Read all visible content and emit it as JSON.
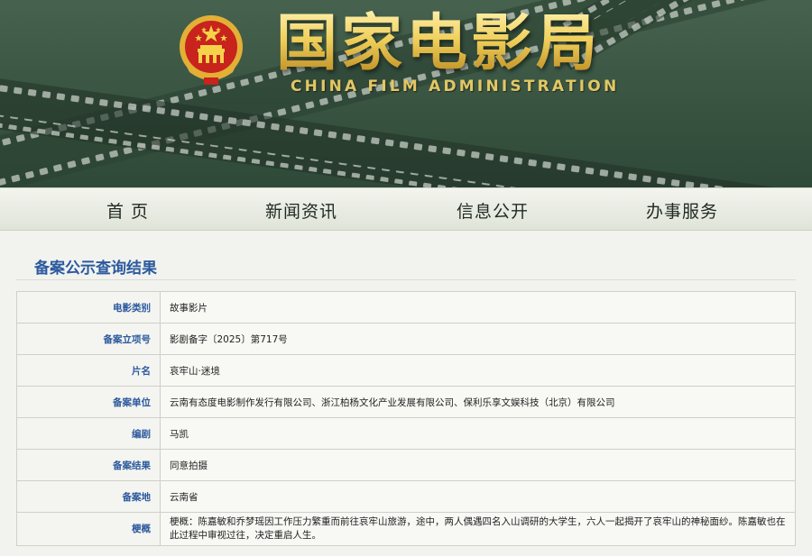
{
  "header": {
    "title_cn": "国家电影局",
    "title_en": "CHINA FILM ADMINISTRATION",
    "emblem_icon": "national-emblem-icon"
  },
  "nav": {
    "items": [
      {
        "label": "首 页"
      },
      {
        "label": "新闻资讯"
      },
      {
        "label": "信息公开"
      },
      {
        "label": "办事服务"
      }
    ]
  },
  "results": {
    "title": "备案公示查询结果",
    "rows": [
      {
        "label": "电影类别",
        "value": "故事影片"
      },
      {
        "label": "备案立项号",
        "value": "影剧备字〔2025〕第717号"
      },
      {
        "label": "片名",
        "value": "哀牢山·迷境"
      },
      {
        "label": "备案单位",
        "value": "云南有态度电影制作发行有限公司、浙江柏杨文化产业发展有限公司、保利乐享文娱科技（北京）有限公司"
      },
      {
        "label": "编剧",
        "value": "马凯"
      },
      {
        "label": "备案结果",
        "value": "同意拍摄"
      },
      {
        "label": "备案地",
        "value": "云南省"
      },
      {
        "label": "梗概",
        "value": "梗概：陈嘉敏和乔梦瑶因工作压力繁重而前往哀牢山旅游，途中，两人偶遇四名入山调研的大学生，六人一起揭开了哀牢山的神秘面纱。陈嘉敏也在此过程中审视过往，决定重启人生。"
      }
    ]
  },
  "colors": {
    "banner_green": "#3e5c47",
    "title_gold": "#e8c24a",
    "label_blue": "#2c5a9e"
  }
}
